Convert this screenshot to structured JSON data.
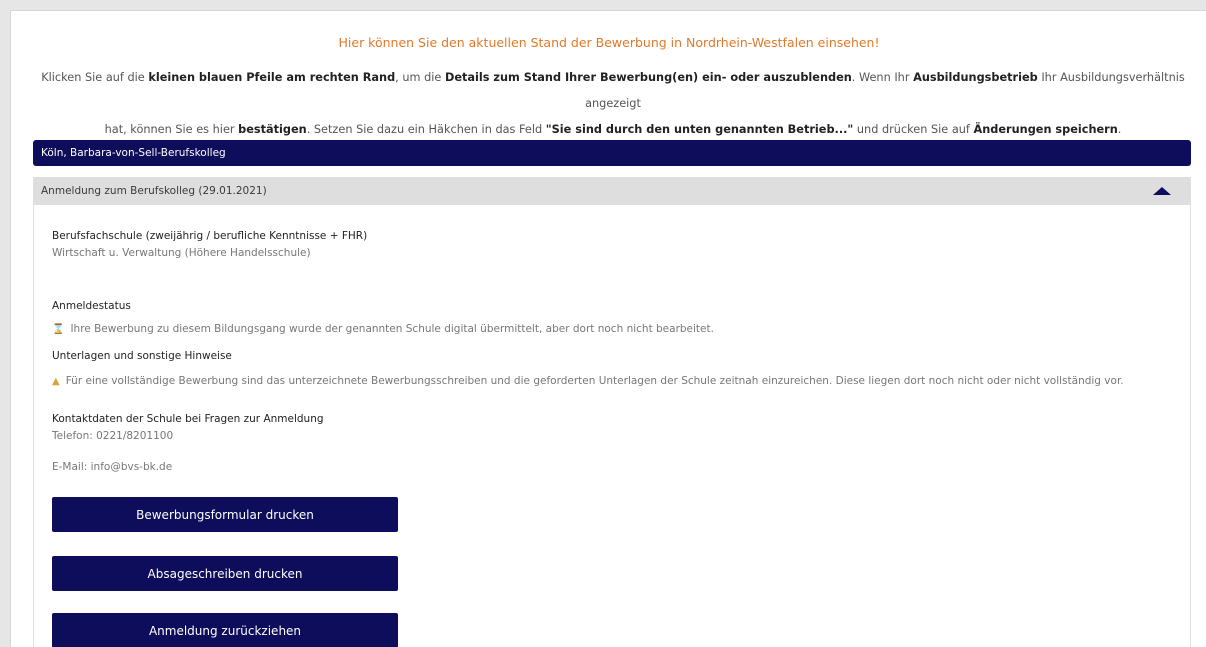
{
  "header": {
    "headline": "Hier können Sie den aktuellen Stand der Bewerbung in Nordrhein-Westfalen einsehen!",
    "intro_line1": [
      {
        "t": "Klicken Sie auf die ",
        "b": false
      },
      {
        "t": "kleinen blauen Pfeile am rechten Rand",
        "b": true
      },
      {
        "t": ", um die ",
        "b": false
      },
      {
        "t": "Details zum Stand Ihrer Bewerbung(en) ein- oder auszublenden",
        "b": true
      },
      {
        "t": ". Wenn Ihr ",
        "b": false
      },
      {
        "t": "Ausbildungsbetrieb",
        "b": true
      },
      {
        "t": " Ihr Ausbildungsverhältnis angezeigt",
        "b": false
      }
    ],
    "intro_line2": [
      {
        "t": "hat, können Sie es hier ",
        "b": false
      },
      {
        "t": "bestätigen",
        "b": true
      },
      {
        "t": ". Setzen Sie dazu ein Häkchen in das Feld ",
        "b": false
      },
      {
        "t": "\"Sie sind durch den unten genannten Betrieb...\"",
        "b": true
      },
      {
        "t": " und drücken Sie auf ",
        "b": false
      },
      {
        "t": "Änderungen speichern",
        "b": true
      },
      {
        "t": ".",
        "b": false
      }
    ]
  },
  "school": {
    "name": "Köln, Barbara-von-Sell-Berufskolleg"
  },
  "application": {
    "header": "Anmeldung zum Berufskolleg (29.01.2021)",
    "program_title": "Berufsfachschule (zweijährig / berufliche Kenntnisse + FHR)",
    "program_sub": "Wirtschaft u. Verwaltung (Höhere Handelsschule)",
    "status_label": "Anmeldestatus",
    "status_icon": "hourglass-icon",
    "status_text": "Ihre Bewerbung zu diesem Bildungsgang wurde der genannten Schule digital übermittelt, aber dort noch nicht bearbeitet.",
    "notes_label": "Unterlagen und sonstige Hinweise",
    "notes_icon": "warning-icon",
    "notes_text": "Für eine vollständige Bewerbung sind das unterzeichnete Bewerbungsschreiben und die geforderten Unterlagen der Schule zeitnah einzureichen. Diese liegen dort noch nicht oder nicht vollständig vor.",
    "contact_label": "Kontaktdaten der Schule bei Fragen zur Anmeldung",
    "phone": "Telefon: 0221/8201100",
    "email": "E-Mail: info@bvs-bk.de"
  },
  "buttons": {
    "print_form": "Bewerbungsformular drucken",
    "print_rejection": "Absageschreiben drucken",
    "withdraw": "Anmeldung zurückziehen"
  },
  "colors": {
    "navy": "#0d0d5c",
    "headline_orange": "#e07a2a",
    "accordion_gray": "#dedede",
    "warning_yellow": "#d9a43a"
  }
}
